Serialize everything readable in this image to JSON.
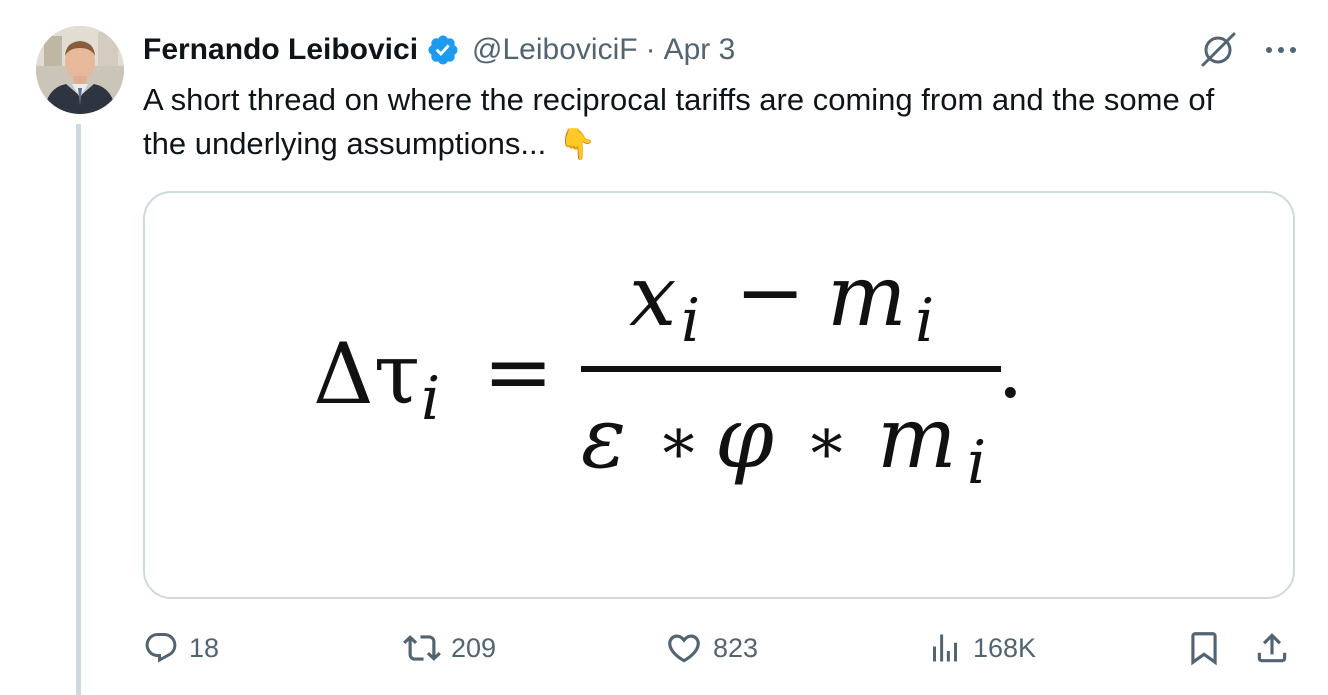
{
  "tweet": {
    "author_name": "Fernando Leibovici",
    "handle": "@LeiboviciF",
    "separator": "·",
    "date": "Apr 3",
    "text": "A short thread on where the reciprocal tariffs are coming from and the some of the underlying assumptions...",
    "emoji": "👇",
    "verified": true,
    "accent_color": "#1d9bf0"
  },
  "media": {
    "formula": {
      "lhs": "Δτ",
      "lhs_subscript": "i",
      "equals": "=",
      "numerator_x": "x",
      "numerator_x_sub": "i",
      "minus": "−",
      "numerator_m": "m",
      "numerator_m_sub": "i",
      "denominator_epsilon": "ε",
      "star1": "∗",
      "denominator_phi": "φ",
      "star2": "∗",
      "denominator_m": "m",
      "denominator_m_sub": "i",
      "period": "."
    }
  },
  "actions": {
    "replies": "18",
    "reposts": "209",
    "likes": "823",
    "views": "168K"
  },
  "icons": {
    "reply": "reply-icon",
    "repost": "repost-icon",
    "like": "heart-icon",
    "views": "views-icon",
    "bookmark": "bookmark-icon",
    "share": "share-icon",
    "grok": "grok-icon",
    "more": "more-icon",
    "verified": "verified-badge-icon"
  }
}
